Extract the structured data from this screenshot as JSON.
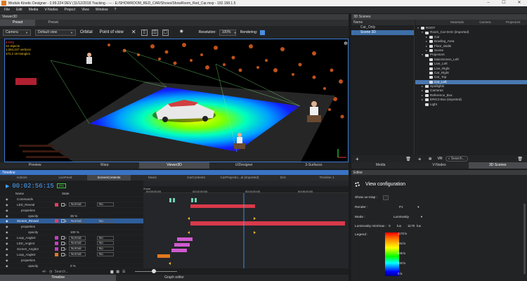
{
  "window": {
    "title": "Modulo Kinetic Designer - 2.99.224 DEV (11/12/2018 Tracking - ---  - E:/SHOWROOM_RED_CAR/Shows/ShowRoom_Red_Car.mxp - 192.168.1.5",
    "min": "–",
    "max": "☐",
    "close": "✕"
  },
  "menu": [
    "File",
    "Edit",
    "Media",
    "V-Nodes",
    "Project",
    "View",
    "Window",
    "?"
  ],
  "viewer": {
    "title": "Viewer3D",
    "tabs": [
      "Preset",
      "Preset"
    ],
    "camera": "Camera",
    "view": "Default view",
    "orbital": "Orbital",
    "pov": "Point of view",
    "resolution_label": "Resolution:",
    "resolution": "100%",
    "rendering_label": "Rendering:",
    "stats": [
      "9 FPS",
      "32 objects",
      "1,084,247 vertices",
      "372,2 19 triangles"
    ],
    "bottom_tabs": [
      "Preview",
      "Warp",
      "Viewer3D",
      "UIDesigner",
      "3-Surfaces"
    ]
  },
  "scenes": {
    "title": "3D Scenes",
    "list_header": "Name",
    "list": [
      "Car_Only",
      "Scene 3D"
    ],
    "tabs": [
      "",
      "Materials",
      "Camera",
      "Projectors"
    ],
    "tree": [
      {
        "d": 0,
        "t": "ROOT",
        "e": "▾"
      },
      {
        "d": 1,
        "t": "Room_Car-DAE (imported)",
        "e": "▾"
      },
      {
        "d": 2,
        "t": "Car",
        "e": "▸"
      },
      {
        "d": 2,
        "t": "Bowling_Area",
        "e": "▸"
      },
      {
        "d": 2,
        "t": "Floor_Walls",
        "e": "▸"
      },
      {
        "d": 2,
        "t": "Scene",
        "e": "▸"
      },
      {
        "d": 1,
        "t": "Projectors",
        "e": "▾"
      },
      {
        "d": 2,
        "t": "MainScreen_Left",
        "e": ""
      },
      {
        "d": 2,
        "t": "Live_Left",
        "e": ""
      },
      {
        "d": 2,
        "t": "Live_Right",
        "e": ""
      },
      {
        "d": 2,
        "t": "Car_Right",
        "e": ""
      },
      {
        "d": 2,
        "t": "Car_Top",
        "e": ""
      },
      {
        "d": 2,
        "t": "Car_Left",
        "e": "",
        "sel": true
      },
      {
        "d": 1,
        "t": "Spotlights",
        "e": "▸"
      },
      {
        "d": 1,
        "t": "Cameras",
        "e": "▸"
      },
      {
        "d": 1,
        "t": "Reference_Box",
        "e": "▸"
      },
      {
        "d": 1,
        "t": "ERIC3 Box (imported)",
        "e": "▸"
      },
      {
        "d": 1,
        "t": "Light",
        "e": ""
      }
    ],
    "search": "Search...",
    "vr": "VR",
    "bottom_tabs": [
      "Media",
      "V-Nodes",
      "3D Scenes"
    ]
  },
  "timeline": {
    "title": "Timeline",
    "tabs": [
      "Actions",
      "LiveFeed",
      "ScreenContents",
      "Music",
      "CarContents",
      "CarProjectio...al (imported)",
      "Eric",
      "Timeline 1"
    ],
    "timecode": "00:02:56:15",
    "tag": "ON",
    "col_name": "Name",
    "col_state": "State",
    "zoom": "Zoom",
    "ruler": [
      "00:00:00:00",
      "00:02:00:00",
      "00:04:00:00",
      "00:06:00:00"
    ],
    "layers": [
      {
        "n": "Commands",
        "k": "head"
      },
      {
        "n": "LED_Reveal",
        "c": "#e04060",
        "m": "Normal",
        "a": "No",
        "v": "1"
      },
      {
        "n": "properties",
        "k": "sub"
      },
      {
        "n": "opacity",
        "k": "prop",
        "v": "36 %"
      },
      {
        "n": "Screen_Reveal",
        "c": "#e04060",
        "m": "Normal",
        "a": "No",
        "v": "1",
        "sel": true
      },
      {
        "n": "properties",
        "k": "sub"
      },
      {
        "n": "opacity",
        "k": "prop",
        "v": "100 %"
      },
      {
        "n": "Loop_Angle3",
        "c": "#c040c0",
        "m": "Normal",
        "a": "No",
        "v": "1"
      },
      {
        "n": "LED_Angle3",
        "c": "#c040c0",
        "m": "Normal",
        "a": "No",
        "v": "1"
      },
      {
        "n": "Screen_Angle3",
        "c": "#c040c0",
        "m": "Normal",
        "a": "No",
        "v": "1"
      },
      {
        "n": "Loop_Angle2",
        "c": "#e07a1f",
        "m": "Normal",
        "a": "No",
        "v": "1"
      },
      {
        "n": "properties",
        "k": "sub"
      },
      {
        "n": "opacity",
        "k": "prop",
        "v": "0 %"
      }
    ],
    "search": "Search...",
    "bottom_tabs": [
      "Timeline",
      "Graph editor"
    ]
  },
  "editor": {
    "title": "Editor",
    "heading": "View configuration",
    "show_uv": "Show uv-map :",
    "render_label": "Render :",
    "render": "PJ",
    "mode_label": "Mode :",
    "mode": "Luminosity",
    "lum_label": "Luminosity min/max :",
    "lum_min": "0",
    "lum_unit": "lux",
    "lum_max": "1170",
    "lum_unit2": "lux",
    "legend_label": "Legend :",
    "legend": [
      "1170 lx",
      "884 lx",
      "585 lx",
      "293 lx",
      "0 lx"
    ]
  }
}
